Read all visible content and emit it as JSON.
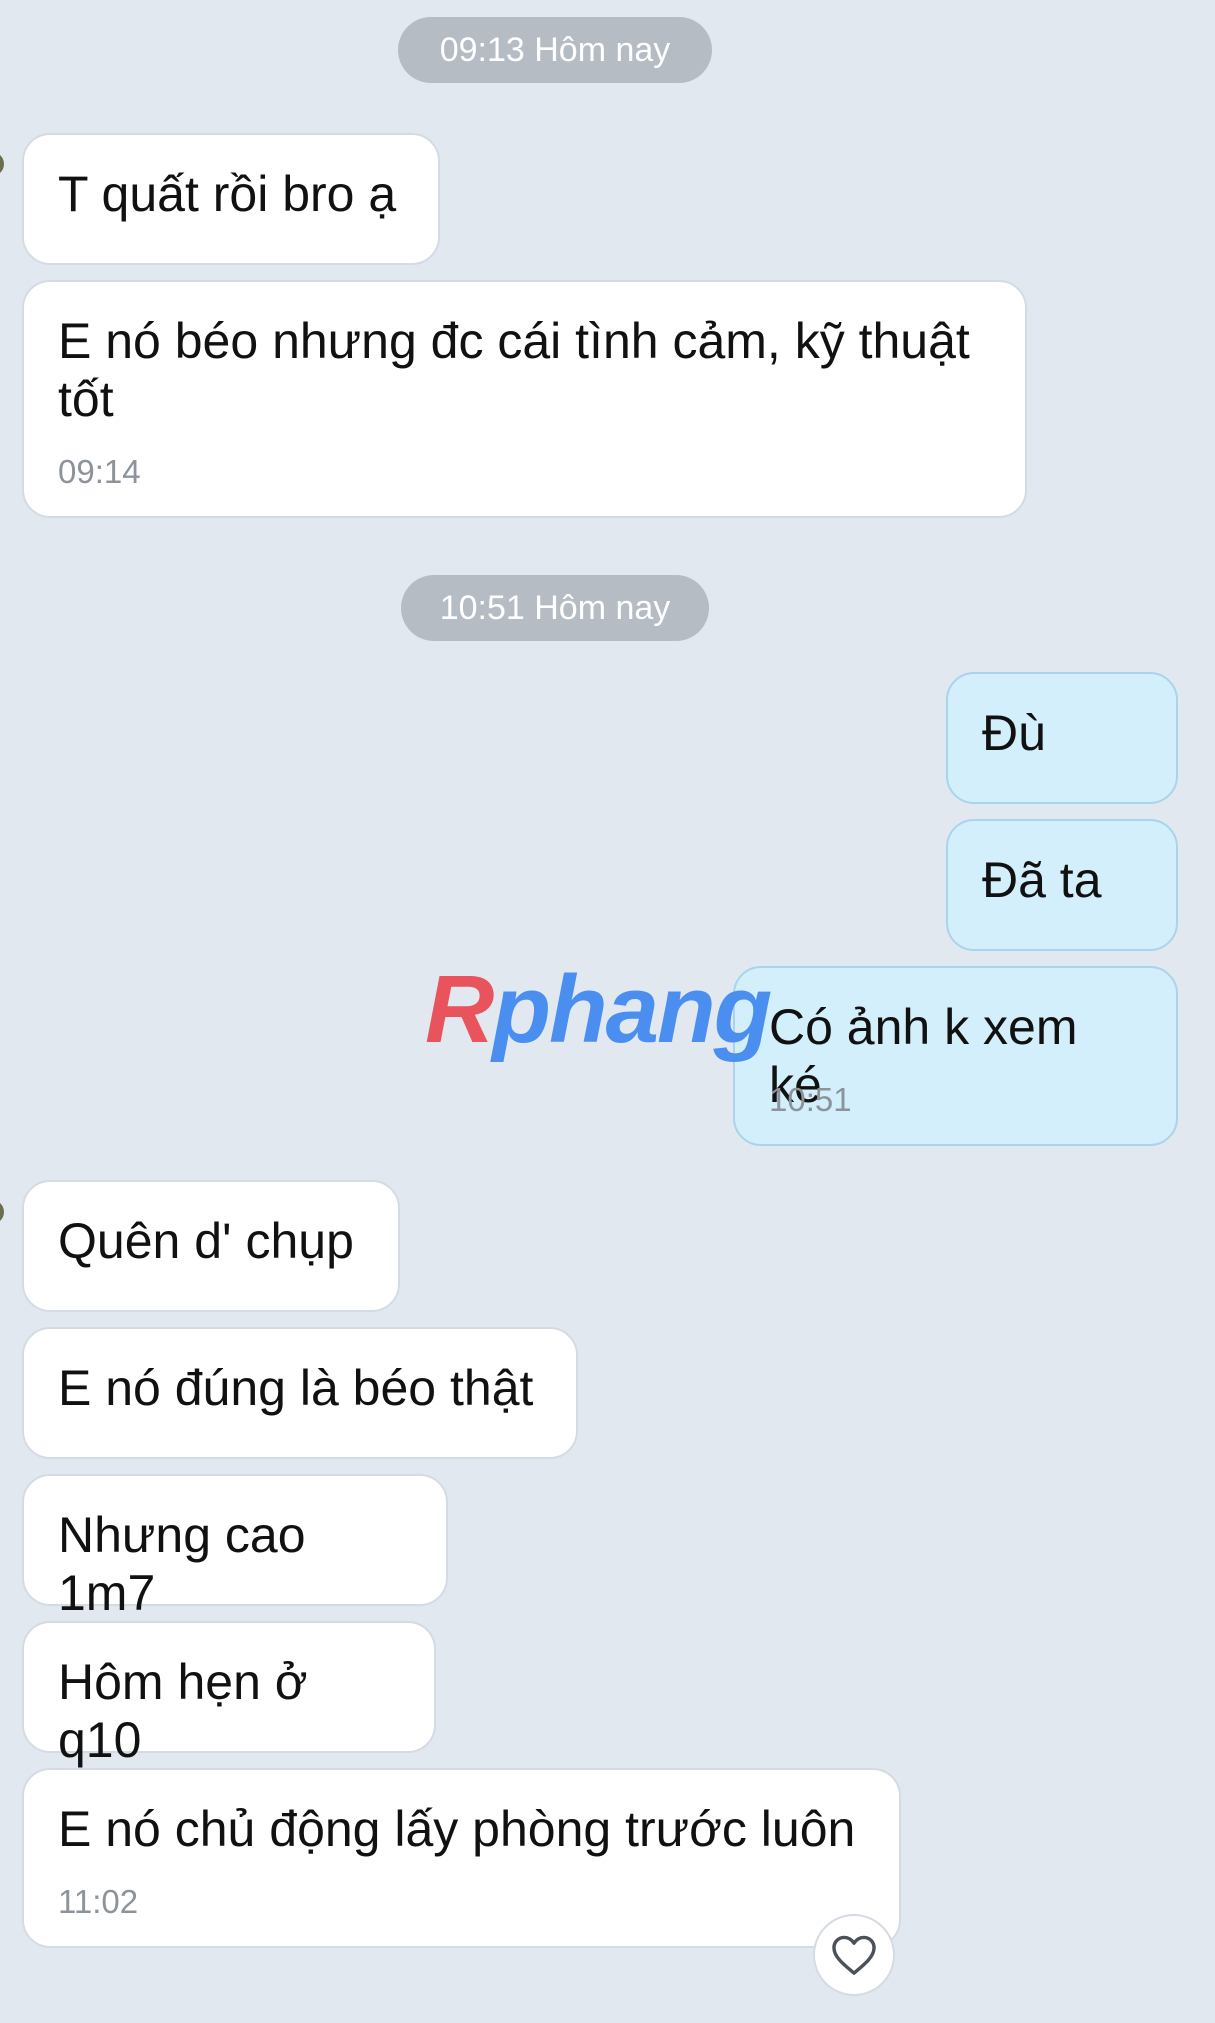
{
  "timestamps": [
    {
      "label": "09:13 Hôm nay"
    },
    {
      "label": "10:51 Hôm nay"
    }
  ],
  "messages": [
    {
      "direction": "in",
      "text": "T quất rồi bro ạ",
      "time": ""
    },
    {
      "direction": "in",
      "text": "E nó béo nhưng đc cái tình cảm, kỹ thuật tốt",
      "time": "09:14"
    },
    {
      "direction": "out",
      "text": "Đù",
      "time": ""
    },
    {
      "direction": "out",
      "text": "Đã ta",
      "time": ""
    },
    {
      "direction": "out",
      "text": "Có ảnh k xem ké",
      "time": "10:51"
    },
    {
      "direction": "in",
      "text": "Quên d' chụp",
      "time": ""
    },
    {
      "direction": "in",
      "text": "E nó đúng là béo thật",
      "time": ""
    },
    {
      "direction": "in",
      "text": "Nhưng cao 1m7",
      "time": ""
    },
    {
      "direction": "in",
      "text": "Hôm hẹn ở q10",
      "time": ""
    },
    {
      "direction": "in",
      "text": "E nó chủ động lấy phòng trước luôn",
      "time": "11:02"
    }
  ],
  "watermark": {
    "first": "R",
    "rest": "phang"
  },
  "reaction": {
    "icon": "heart-icon"
  },
  "colors": {
    "background": "#e2e8f0",
    "incoming_bubble": "#ffffff",
    "outgoing_bubble": "#d3effc",
    "timestamp_pill": "#b6bcc4",
    "watermark_red": "#e9535b",
    "watermark_blue": "#4a8ff0"
  }
}
